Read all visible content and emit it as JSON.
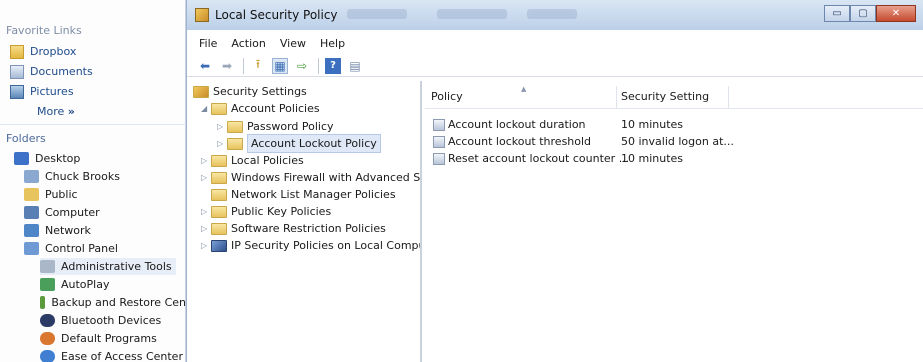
{
  "explorer": {
    "favorite_links_title": "Favorite Links",
    "favorites": [
      {
        "label": "Dropbox",
        "icon": "dropbox-folder-icon"
      },
      {
        "label": "Documents",
        "icon": "documents-icon"
      },
      {
        "label": "Pictures",
        "icon": "pictures-icon"
      }
    ],
    "more_label": "More",
    "more_glyph": "»",
    "folders_title": "Folders",
    "tree": [
      {
        "label": "Desktop",
        "icon": "desktop-icon",
        "color": "#3d72c8"
      },
      {
        "label": "Chuck Brooks",
        "icon": "user-folder-icon",
        "color": "#8aa8d0"
      },
      {
        "label": "Public",
        "icon": "folder-icon",
        "color": "#e8c45f"
      },
      {
        "label": "Computer",
        "icon": "computer-icon",
        "color": "#5a7fb5"
      },
      {
        "label": "Network",
        "icon": "network-icon",
        "color": "#4f86c8"
      },
      {
        "label": "Control Panel",
        "icon": "control-panel-icon",
        "color": "#6f9ad4"
      },
      {
        "label": "Administrative Tools",
        "icon": "admin-tools-icon",
        "color": "#a9b7c9"
      },
      {
        "label": "AutoPlay",
        "icon": "autoplay-icon",
        "color": "#4aa05a"
      },
      {
        "label": "Backup and Restore Cen",
        "icon": "backup-icon",
        "color": "#5c9a3c"
      },
      {
        "label": "Bluetooth Devices",
        "icon": "bluetooth-icon",
        "color": "#2b3b66"
      },
      {
        "label": "Default Programs",
        "icon": "default-programs-icon",
        "color": "#d9772f"
      },
      {
        "label": "Ease of Access Center",
        "icon": "ease-of-access-icon",
        "color": "#3f7ed1"
      }
    ]
  },
  "window": {
    "title": "Local Security Policy",
    "minimize_glyph": "▭",
    "maximize_glyph": "▢",
    "close_glyph": "✕",
    "menu": [
      "File",
      "Action",
      "View",
      "Help"
    ],
    "toolbar_icons": [
      "back-arrow-icon",
      "forward-arrow-icon",
      "up-folder-icon",
      "show-hide-tree-icon",
      "export-list-icon",
      "help-icon",
      "properties-icon"
    ],
    "toolbar_glyphs": [
      "⬅",
      "➡",
      "⭱",
      "▦",
      "⇨",
      "?",
      "▤"
    ]
  },
  "scope_tree": {
    "root": "Security Settings",
    "nodes": [
      {
        "label": "Account Policies",
        "expanded": true,
        "level": 1
      },
      {
        "label": "Password Policy",
        "expanded": false,
        "level": 2
      },
      {
        "label": "Account Lockout Policy",
        "expanded": false,
        "level": 2,
        "selected": true
      },
      {
        "label": "Local Policies",
        "expanded": false,
        "level": 1
      },
      {
        "label": "Windows Firewall with Advanced Secu",
        "expanded": false,
        "level": 1
      },
      {
        "label": "Network List Manager Policies",
        "expanded": false,
        "level": 1
      },
      {
        "label": "Public Key Policies",
        "expanded": false,
        "level": 1
      },
      {
        "label": "Software Restriction Policies",
        "expanded": false,
        "level": 1
      },
      {
        "label": "IP Security Policies on Local Compute",
        "expanded": false,
        "level": 1
      }
    ]
  },
  "details": {
    "columns": [
      "Policy",
      "Security Setting"
    ],
    "rows": [
      {
        "policy": "Account lockout duration",
        "setting": "10 minutes"
      },
      {
        "policy": "Account lockout threshold",
        "setting": "50 invalid logon at..."
      },
      {
        "policy": "Reset account lockout counter ...",
        "setting": "10 minutes"
      }
    ]
  }
}
